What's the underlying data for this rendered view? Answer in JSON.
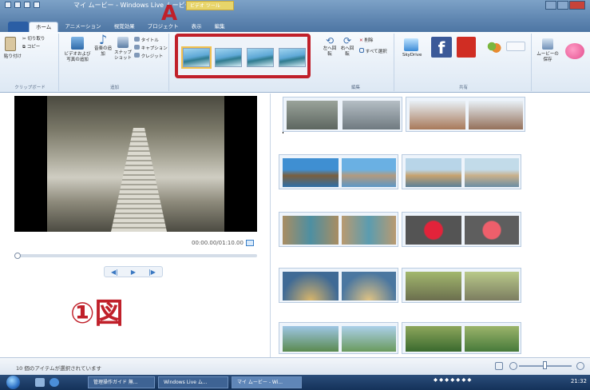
{
  "window": {
    "title": "マイ ムービー - Windows Live ムービー メーカー",
    "context_tab": "ビデオ ツール"
  },
  "tabs": [
    "ホーム",
    "アニメーション",
    "視覚効果",
    "プロジェクト",
    "表示",
    "編集"
  ],
  "ribbon": {
    "clipboard": {
      "paste": "貼り付け",
      "cut": "切り取り",
      "copy": "コピー",
      "group_label": "クリップボード"
    },
    "add": {
      "video_photo": "ビデオおよび写真の追加",
      "music": "音楽の追加",
      "snapshot": "スナップショット",
      "title": "タイトル",
      "caption": "キャプション",
      "credit": "クレジット",
      "group_label": "追加"
    },
    "effects_group": {
      "thumbnails": 4,
      "selected_index": 0
    },
    "edit": {
      "rotate_left": "左へ回転",
      "rotate_right": "右へ回転",
      "delete": "削除",
      "select_all": "すべて選択",
      "group_label": "編集"
    },
    "share": {
      "skydrive": "SkyDrive",
      "save_movie": "ムービーの保存",
      "group_label": "共有"
    }
  },
  "annotations": {
    "label_a": "A",
    "label_fig": "①図"
  },
  "player": {
    "timecode": "00:00.00/01:10.00"
  },
  "status": {
    "text": "10 個のアイテムが選択されています"
  },
  "taskbar": {
    "items": [
      "管理操作ガイド 無...",
      "Windows Live ム...",
      "マイ ムービー - Wi..."
    ],
    "clock": "21:32"
  },
  "colors": {
    "annotation_red": "#c0202a",
    "titlebar": "#5f86b1",
    "taskbar": "#14325a"
  }
}
